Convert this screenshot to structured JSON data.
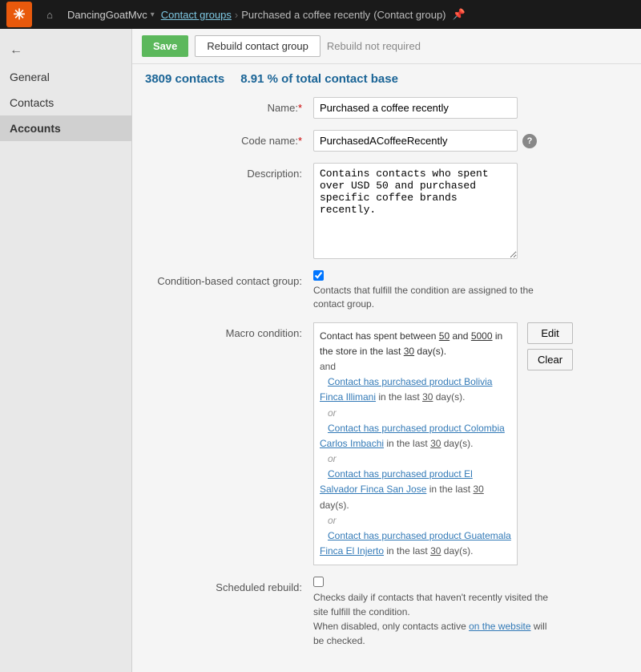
{
  "topnav": {
    "logo": "✳",
    "home_icon": "⌂",
    "app_name": "DancingGoatMvc",
    "app_arrow": "▾",
    "breadcrumb": {
      "section": "Contact groups",
      "current": "Purchased a coffee recently",
      "type": "(Contact group)"
    }
  },
  "toolbar": {
    "save_label": "Save",
    "rebuild_label": "Rebuild contact group",
    "rebuild_status": "Rebuild not required"
  },
  "stats": {
    "contacts": "3809 contacts",
    "percent": "8.91 % of total contact base"
  },
  "sidebar": {
    "back_icon": "←",
    "items": [
      {
        "label": "General",
        "active": false
      },
      {
        "label": "Contacts",
        "active": false
      },
      {
        "label": "Accounts",
        "active": false
      }
    ]
  },
  "form": {
    "name_label": "Name:",
    "name_required": "*",
    "name_value": "Purchased a coffee recently",
    "codename_label": "Code name:",
    "codename_required": "*",
    "codename_value": "PurchasedACoffeeRecently",
    "description_label": "Description:",
    "description_value": "Contains contacts who spent over USD 50 and purchased specific coffee brands recently.",
    "condition_label": "Condition-based contact group:",
    "condition_hint": "Contacts that fulfill the condition are assigned to the contact group.",
    "macro_label": "Macro condition:",
    "macro_lines": [
      {
        "type": "main",
        "text": "Contact has spent between 50 and 5000 in the store in the last 30 day(s)."
      },
      {
        "type": "and",
        "text": "and"
      },
      {
        "type": "link",
        "text": "Contact has purchased product Bolivia Finca Illimani in the last 30 day(s)."
      },
      {
        "type": "or",
        "text": "or"
      },
      {
        "type": "link",
        "text": "Contact has purchased product Colombia Carlos Imbachi in the last 30 day(s)."
      },
      {
        "type": "or",
        "text": "or"
      },
      {
        "type": "link",
        "text": "Contact has purchased product El Salvador Finca San Jose in the last 30 day(s)."
      },
      {
        "type": "or",
        "text": "or"
      },
      {
        "type": "link",
        "text": "Contact has purchased product Guatemala Finca El Injerto in the last 30 day(s)."
      }
    ],
    "macro_edit_label": "Edit",
    "macro_clear_label": "Clear",
    "scheduled_label": "Scheduled rebuild:",
    "scheduled_hint1": "Checks daily if contacts that haven't recently visited the site fulfill the condition.",
    "scheduled_hint2": "When disabled, only contacts active on the website will be checked.",
    "scheduled_hint_link": "on the website",
    "help_icon": "?"
  }
}
